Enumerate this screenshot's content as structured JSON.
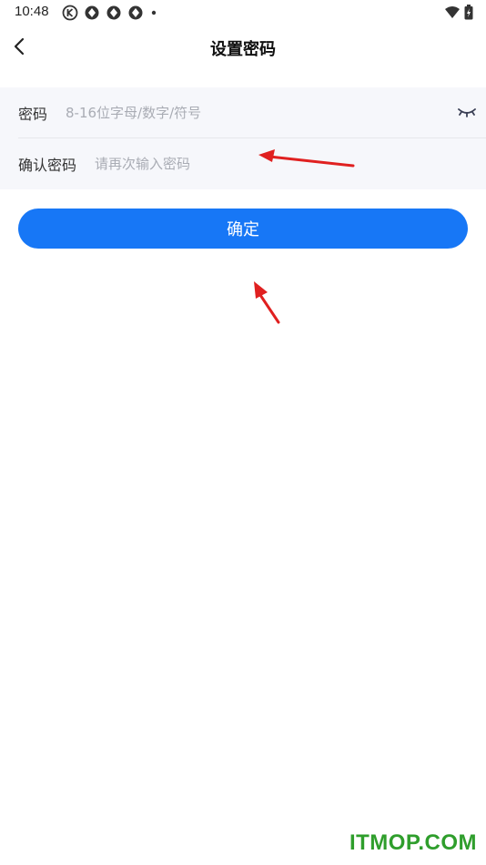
{
  "status_bar": {
    "time": "10:48",
    "icons": [
      "k-circle-icon",
      "aperture-icon",
      "aperture-icon",
      "aperture-icon",
      "dot-icon"
    ],
    "right_icons": [
      "wifi-icon",
      "battery-charging-icon"
    ]
  },
  "nav": {
    "title": "设置密码",
    "back_icon": "chevron-left-icon"
  },
  "form": {
    "password": {
      "label": "密码",
      "value": "",
      "placeholder": "8-16位字母/数字/符号",
      "toggle_icon": "eye-closed-icon"
    },
    "confirm_password": {
      "label": "确认密码",
      "value": "",
      "placeholder": "请再次输入密码"
    }
  },
  "confirm_button": {
    "label": "确定"
  },
  "annotations": {
    "arrow_color": "#e02020"
  },
  "watermark": {
    "text": "ITMOP.COM",
    "color": "#2f9e2c"
  },
  "colors": {
    "accent": "#1777f6",
    "form_background": "#f6f7fb"
  }
}
